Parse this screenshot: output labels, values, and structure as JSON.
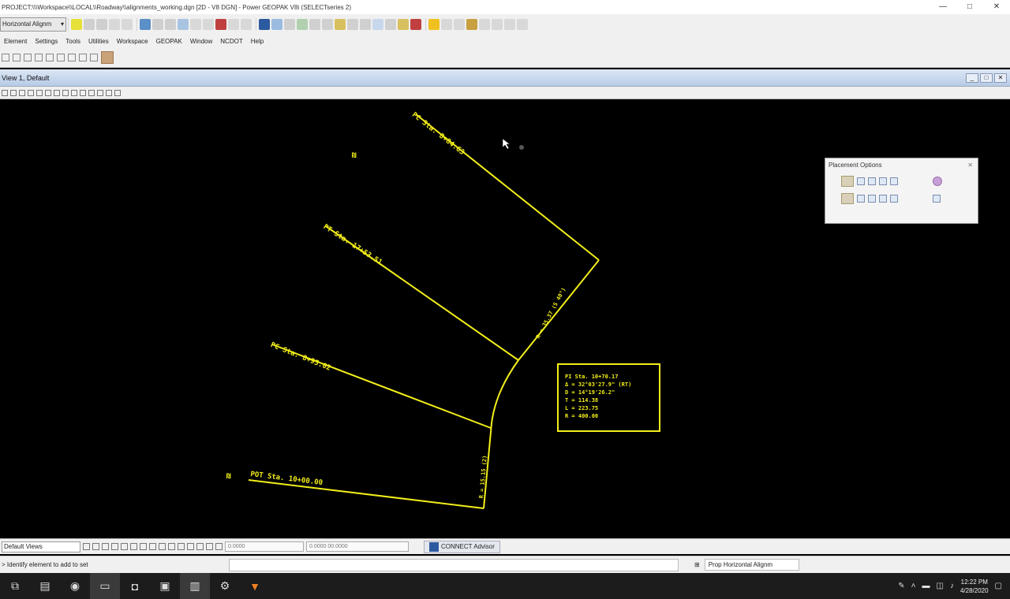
{
  "window": {
    "title": "PROJECT:\\\\\\Workspace\\\\LOCAL\\\\Roadway\\\\alignments_working.dgn [2D - V8 DGN] - Power GEOPAK V8i (SELECTseries 2)",
    "controls": [
      "—",
      "□",
      "✕"
    ]
  },
  "toolbar": {
    "element_template": "Horizontal Alignm"
  },
  "menu": [
    "Element",
    "Settings",
    "Tools",
    "Utilities",
    "Workspace",
    "GEOPAK",
    "Window",
    "NCDOT",
    "Help"
  ],
  "view": {
    "title": "View 1, Default",
    "controls": [
      "_",
      "□",
      "✕"
    ]
  },
  "drawing": {
    "pc_labels": [
      "PC Sta. 8+84.63",
      "PT Sta. 17+53.51",
      "PC Sta. 8+95.02",
      "POT Sta. 10+00.00"
    ],
    "station_labels": [
      "R = 35.37 (S 40°)",
      "R = 15.15 (2)"
    ],
    "marker_labels": [
      "₪",
      "₪"
    ],
    "curve_data": [
      "PI Sta. 10+70.17",
      "Δ = 32°03'27.9\" (RT)",
      "D = 14°19'26.2\"",
      "T = 114.38",
      "L = 223.75",
      "R = 400.00"
    ]
  },
  "placement_panel": {
    "title": "Placement Options"
  },
  "bottom": {
    "view_combo": "Default Views",
    "xy_field": "0.0000",
    "coord_field": "0.0000 00.0000",
    "advisor_label": "CONNECT Advisor"
  },
  "status": {
    "prompt": "> Identify element to add to set",
    "active_tool": "Prop Horizontal Alignm"
  },
  "taskbar": {
    "time": "12:22 PM",
    "date": "4/28/2020"
  },
  "colors": {
    "cad_yellow": "#f2ee1a",
    "canvas": "#000000"
  }
}
